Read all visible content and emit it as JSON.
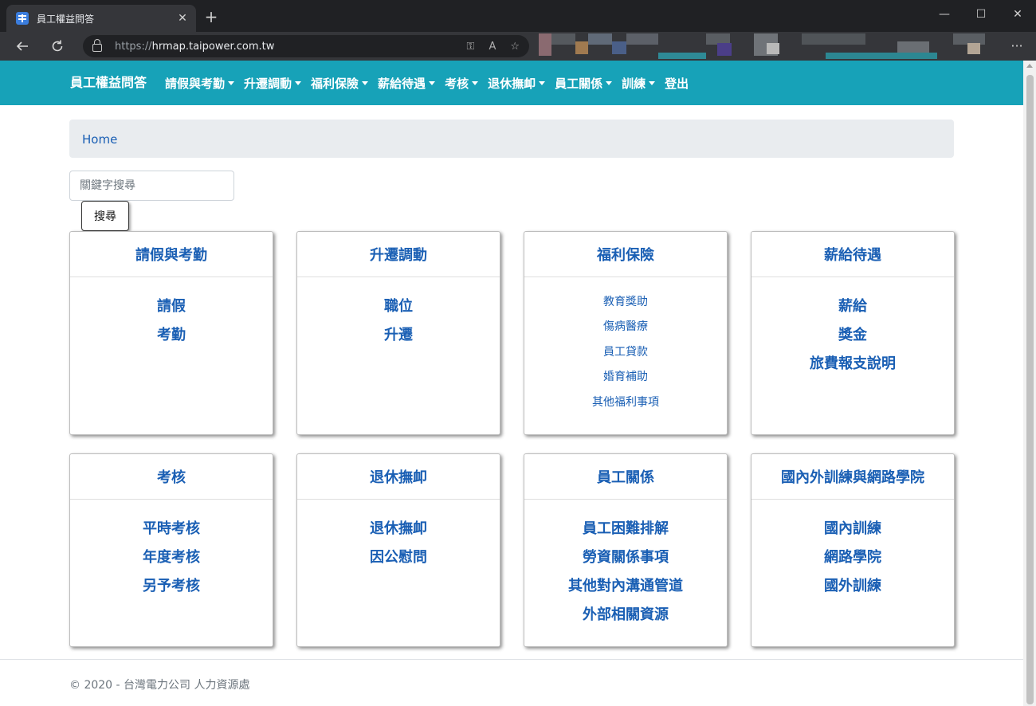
{
  "browser": {
    "tab_title": "員工權益問答",
    "tab_close": "✕",
    "new_tab": "+",
    "url_proto": "https://",
    "url_host": "hrmap.taipower.com.tw",
    "minimize": "—",
    "maximize": "☐",
    "close": "✕",
    "more": "···"
  },
  "navbar": {
    "brand": "員工權益問答",
    "menu": [
      {
        "label": "請假與考勤"
      },
      {
        "label": "升遷調動"
      },
      {
        "label": "福利保險"
      },
      {
        "label": "薪給待遇"
      },
      {
        "label": "考核"
      },
      {
        "label": "退休撫卹"
      },
      {
        "label": "員工關係"
      },
      {
        "label": "訓練"
      }
    ],
    "logout": "登出",
    "bg_color": "#17a2b8"
  },
  "breadcrumb": {
    "home": "Home"
  },
  "search": {
    "placeholder": "關鍵字搜尋",
    "button": "搜尋"
  },
  "cards": [
    {
      "title": "請假與考勤",
      "links": [
        "請假",
        "考勤"
      ]
    },
    {
      "title": "升遷調動",
      "links": [
        "職位",
        "升遷"
      ]
    },
    {
      "title": "福利保險",
      "links": [
        "教育獎助",
        "傷病醫療",
        "員工貸款",
        "婚育補助",
        "其他福利事項"
      ]
    },
    {
      "title": "薪給待遇",
      "links": [
        "薪給",
        "獎金",
        "旅費報支說明"
      ]
    },
    {
      "title": "考核",
      "links": [
        "平時考核",
        "年度考核",
        "另予考核"
      ]
    },
    {
      "title": "退休撫卹",
      "links": [
        "退休撫卹",
        "因公慰問"
      ]
    },
    {
      "title": "員工關係",
      "links": [
        "員工困難排解",
        "勞資關係事項",
        "其他對內溝通管道",
        "外部相關資源"
      ]
    },
    {
      "title": "國內外訓練與網路學院",
      "links": [
        "國內訓練",
        "網路學院",
        "國外訓練"
      ]
    }
  ],
  "footer": {
    "text": "© 2020 - 台灣電力公司 人力資源處"
  },
  "colors": {
    "link": "#1a5fb4",
    "breadcrumb_bg": "#e9ecef"
  }
}
